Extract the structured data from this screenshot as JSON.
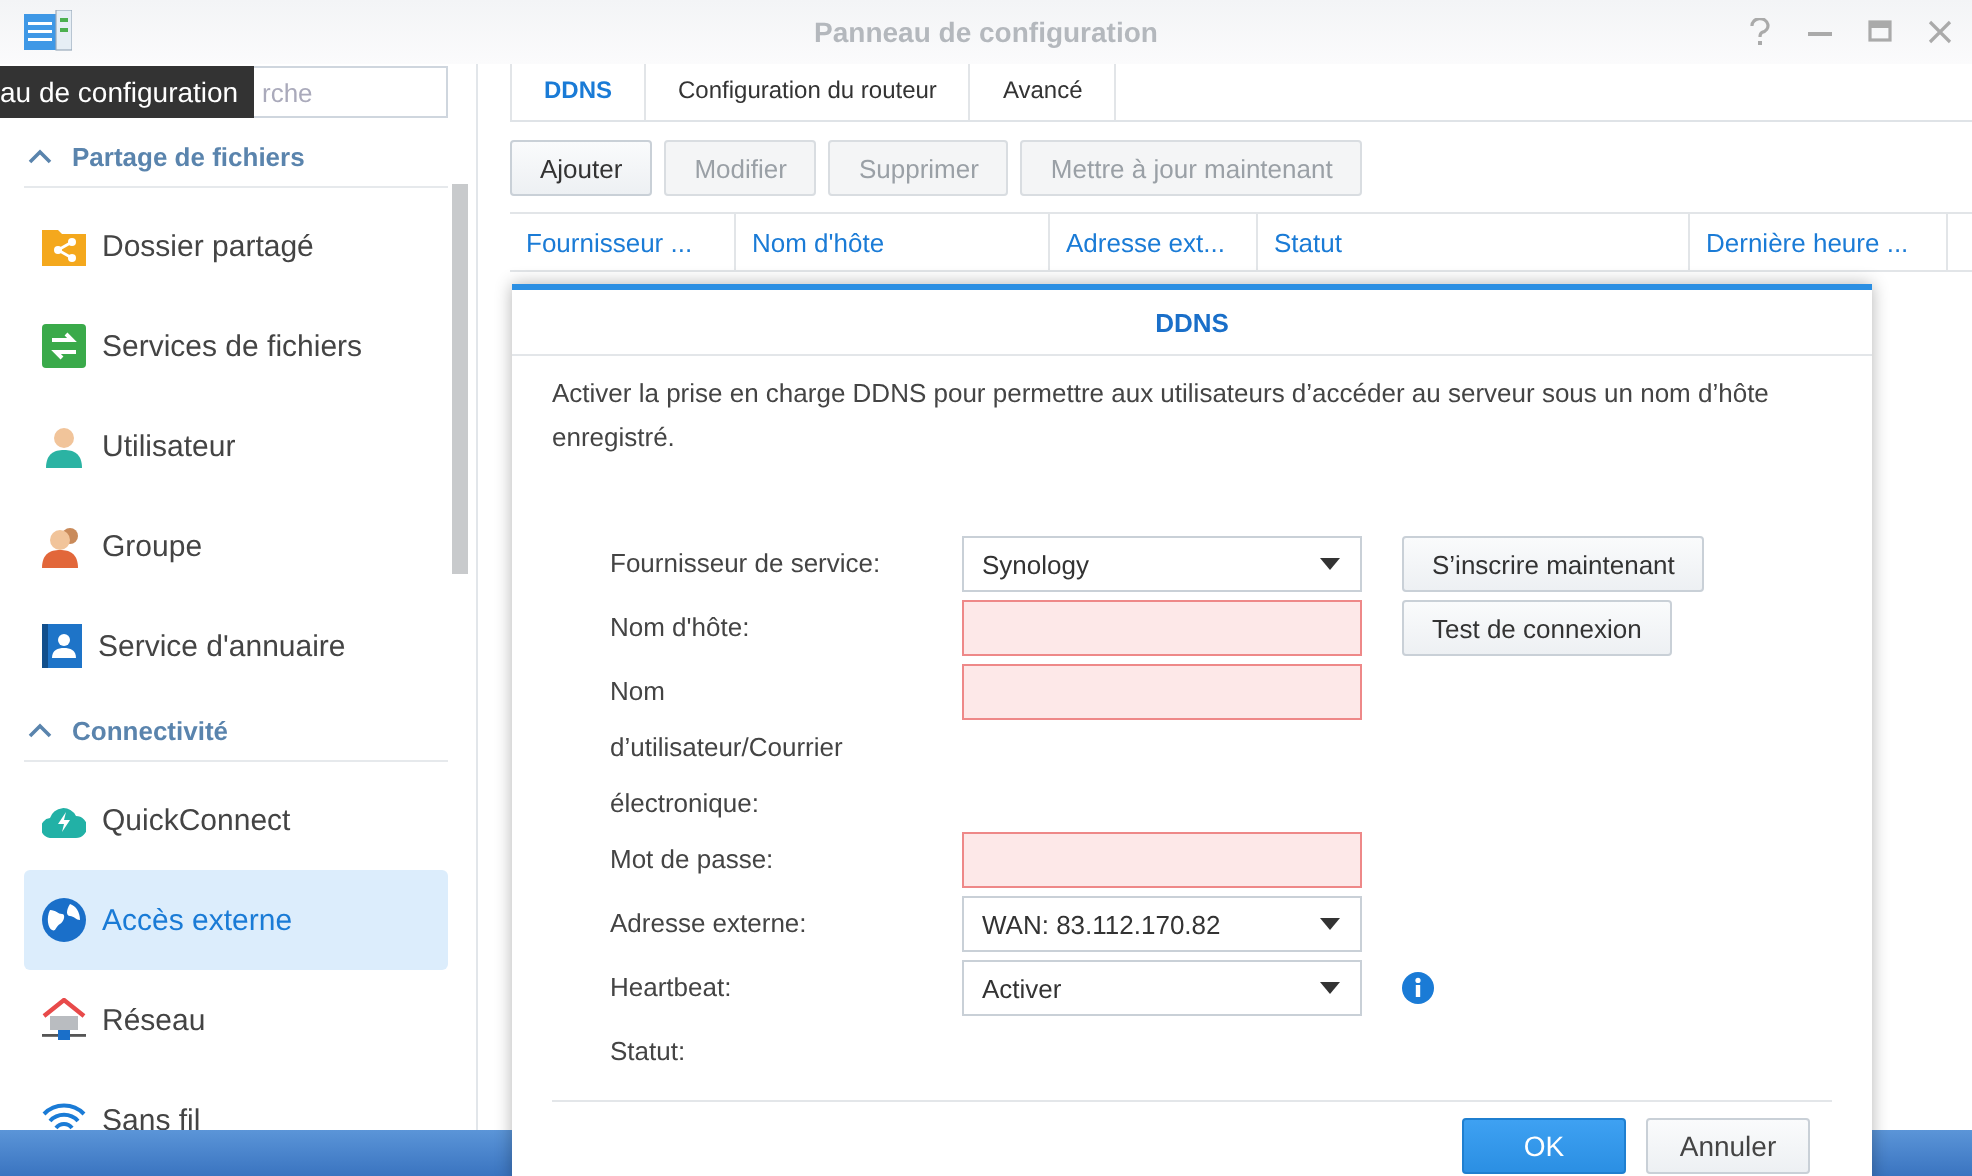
{
  "window": {
    "title": "Panneau de configuration"
  },
  "tooltip": "au de configuration",
  "search": {
    "placeholder": "rche"
  },
  "sidebar": {
    "groups": [
      {
        "title": "Partage de fichiers",
        "expanded": true,
        "items": [
          {
            "label": "Dossier partagé",
            "selected": false
          },
          {
            "label": "Services de fichiers",
            "selected": false
          },
          {
            "label": "Utilisateur",
            "selected": false
          },
          {
            "label": "Groupe",
            "selected": false
          },
          {
            "label": "Service d'annuaire",
            "selected": false
          }
        ]
      },
      {
        "title": "Connectivité",
        "expanded": true,
        "items": [
          {
            "label": "QuickConnect",
            "selected": false
          },
          {
            "label": "Accès externe",
            "selected": true
          },
          {
            "label": "Réseau",
            "selected": false
          },
          {
            "label": "Sans fil",
            "selected": false
          }
        ]
      }
    ]
  },
  "tabs": [
    {
      "label": "DDNS",
      "selected": true
    },
    {
      "label": "Configuration du routeur",
      "selected": false
    },
    {
      "label": "Avancé",
      "selected": false
    }
  ],
  "toolbar": [
    {
      "label": "Ajouter",
      "disabled": false
    },
    {
      "label": "Modifier",
      "disabled": true
    },
    {
      "label": "Supprimer",
      "disabled": true
    },
    {
      "label": "Mettre à jour maintenant",
      "disabled": true
    }
  ],
  "table": {
    "columns": [
      "Fournisseur ...",
      "Nom d'hôte",
      "Adresse ext...",
      "Statut",
      "Dernière heure ..."
    ]
  },
  "dialog": {
    "title": "DDNS",
    "description": "Activer la prise en charge DDNS pour permettre aux utilisateurs d’accéder au serveur sous un nom d’hôte enregistré.",
    "fields": [
      {
        "label": "Fournisseur de service:",
        "kind": "select",
        "value": "Synology",
        "invalid": false,
        "side": {
          "kind": "button",
          "label": "S’inscrire maintenant"
        }
      },
      {
        "label": "Nom d'hôte:",
        "kind": "input",
        "invalid": true,
        "side": {
          "kind": "button",
          "label": "Test de connexion"
        }
      },
      {
        "label": "Nom d’utilisateur/Courrier électronique:",
        "kind": "input",
        "invalid": true
      },
      {
        "label": "Mot de passe:",
        "kind": "input",
        "invalid": true
      },
      {
        "label": "Adresse externe:",
        "kind": "select",
        "value": "WAN: 83.112.170.82",
        "invalid": false
      },
      {
        "label": "Heartbeat:",
        "kind": "select",
        "value": "Activer",
        "invalid": false,
        "side": {
          "kind": "info"
        }
      },
      {
        "label": "Statut:",
        "kind": "text"
      }
    ],
    "buttons": [
      {
        "label": "OK",
        "primary": true
      },
      {
        "label": "Annuler",
        "primary": false
      }
    ]
  }
}
